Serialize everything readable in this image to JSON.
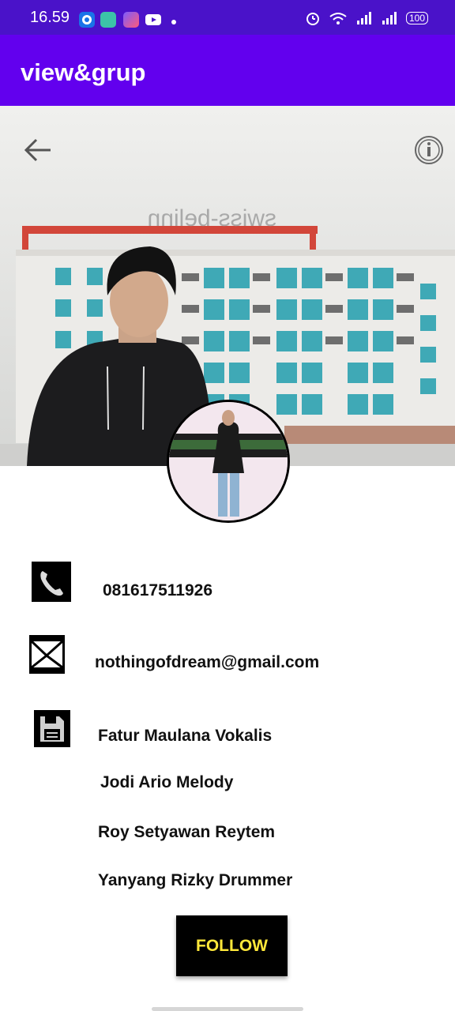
{
  "status_bar": {
    "time": "16.59",
    "battery": "100",
    "icons": [
      "chrome-notif-icon",
      "alarm-app-icon",
      "shortcut-app-icon",
      "youtube-icon",
      "alarm-clock-icon",
      "wifi-icon",
      "signal-icon",
      "signal-icon-2",
      "battery-icon"
    ]
  },
  "app_bar": {
    "title": "view&grup"
  },
  "header": {
    "icons": [
      "back-arrow-icon",
      "info-icon"
    ],
    "building_sign": "swiss-belinn"
  },
  "contact": {
    "phone": "081617511926",
    "email": "nothingofdream@gmail.com"
  },
  "members": [
    "Fatur Maulana Vokalis",
    "Jodi Ario Melody",
    "Roy Setyawan Reytem",
    "Yanyang Rizky Drummer"
  ],
  "follow_label": "FOLLOW",
  "colors": {
    "status_bar": "#4a12c9",
    "app_bar": "#6200ee",
    "follow_text": "#ffe83a"
  }
}
